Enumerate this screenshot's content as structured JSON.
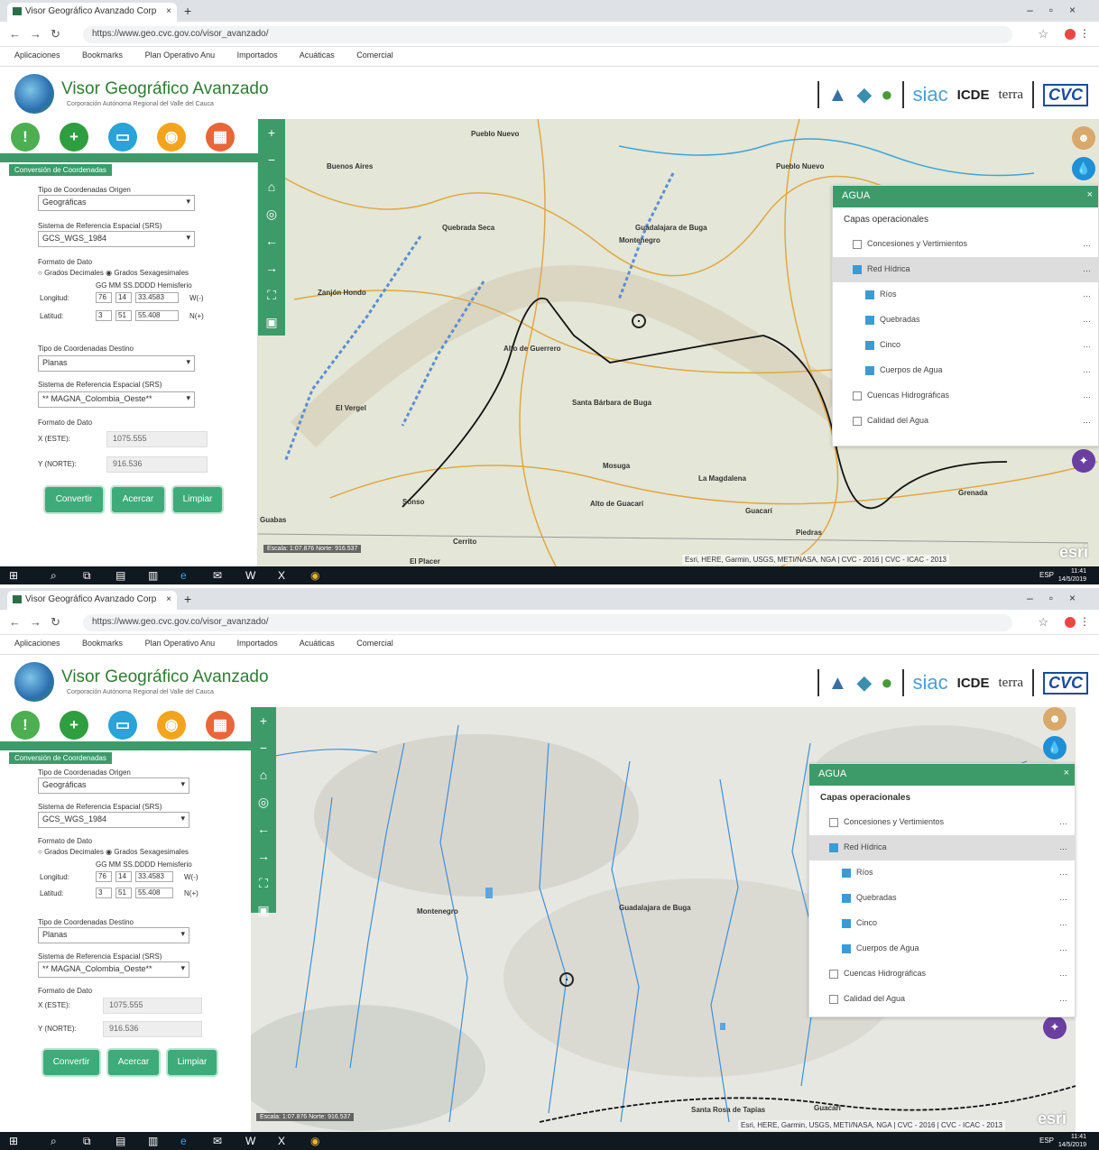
{
  "browser": {
    "tab_title": "Visor Geográfico Avanzado Corp",
    "url": "https://www.geo.cvc.gov.co/visor_avanzado/",
    "bookmarks": [
      "Aplicaciones",
      "Bookmarks",
      "Plan Operativo Anu",
      "Importados",
      "Acuáticas",
      "Comercial"
    ]
  },
  "app": {
    "title": "Visor Geográfico Avanzado",
    "subtitle": "Corporación Autónoma Regional del Valle del Cauca",
    "partners": [
      "siac",
      "ICDE",
      "terra",
      "CVC"
    ]
  },
  "panel": {
    "title": "Conversión de Coordenadas",
    "origin_type_label": "Tipo de Coordenadas Origen",
    "origin_type_value": "Geográficas",
    "ref_system_label": "Sistema de Referencia Espacial (SRS)",
    "ref_system_value": "GCS_WGS_1984",
    "input_format_label": "Formato de Dato",
    "decimal_label": "Grados Decimales",
    "sexagesimal_label": "Grados Sexagesimales",
    "cols": "GG  MM  SS.DDDD  Hemisferio",
    "longitude_label": "Longitud:",
    "latitude_label": "Latitud:",
    "lon_values": [
      "76",
      "14",
      "33.4583",
      "W(-)"
    ],
    "lat_values": [
      "3",
      "51",
      "55.408",
      "N(+)"
    ],
    "dest_type_label": "Tipo de Coordenadas Destino",
    "dest_type_value": "Planas",
    "dest_ref_label": "Sistema de Referencia Espacial (SRS)",
    "dest_ref_value": "** MAGNA_Colombia_Oeste**",
    "out_format_label": "Formato de Dato",
    "x_label": "X (ESTE):",
    "y_label": "Y (NORTE):",
    "x_value": "1075.555",
    "y_value": "916.536",
    "btn_convert": "Convertir",
    "btn_zoom": "Acercar",
    "btn_clear": "Limpiar"
  },
  "agua": {
    "title": "AGUA",
    "subtitle": "Capas operacionales",
    "layers": [
      {
        "name": "Concesiones y Vertimientos",
        "checked": false,
        "indent": 0
      },
      {
        "name": "Red Hídrica",
        "checked": true,
        "indent": 0,
        "highlight": true
      },
      {
        "name": "Ríos",
        "checked": true,
        "indent": 1
      },
      {
        "name": "Quebradas",
        "checked": true,
        "indent": 1
      },
      {
        "name": "Cinco",
        "checked": true,
        "indent": 1
      },
      {
        "name": "Cuerpos de Agua",
        "checked": true,
        "indent": 1
      },
      {
        "name": "Cuencas Hidrográficas",
        "checked": false,
        "indent": 0
      },
      {
        "name": "Calidad del Agua",
        "checked": false,
        "indent": 0
      }
    ]
  },
  "map1": {
    "labels": [
      "Buenos Aires",
      "Pueblo Nuevo",
      "Guadalajara de Buga",
      "Montenegro",
      "Quebrada Seca",
      "Zanjón Hondo",
      "Alto de Guerrero",
      "Santa Bárbara de Buga",
      "El Vergel",
      "Mosuga",
      "La Magdalena",
      "Guacarí",
      "Alto de Guacarí",
      "Pueblo Nuevo",
      "Sonso",
      "Guabas",
      "Piedras",
      "Grenada",
      "Cerrito",
      "El Placer"
    ],
    "status": "Escala: 1:07.876  Norte: 916.537",
    "attribution": "Esri, HERE, Garmin, USGS, METI/NASA, NGA | CVC - 2016 | CVC - ICAC - 2013",
    "esri": "esri"
  },
  "map2": {
    "labels": [
      "Montenegro",
      "Guadalajara de Buga",
      "Guacarí",
      "Santa Rosa de Tapias"
    ],
    "status": "Escala: 1:07.876  Norte: 916.537",
    "attribution": "Esri, HERE, Garmin, USGS, METI/NASA, NGA | CVC - 2016 | CVC - ICAC - 2013",
    "esri": "esri"
  },
  "taskbar": {
    "time": "11:41",
    "date": "14/5/2019",
    "lang": "ESP"
  },
  "colors": {
    "brand_green": "#3d9b6a",
    "button_green": "#3dab7a",
    "checkbox_blue": "#3d9bd4"
  }
}
